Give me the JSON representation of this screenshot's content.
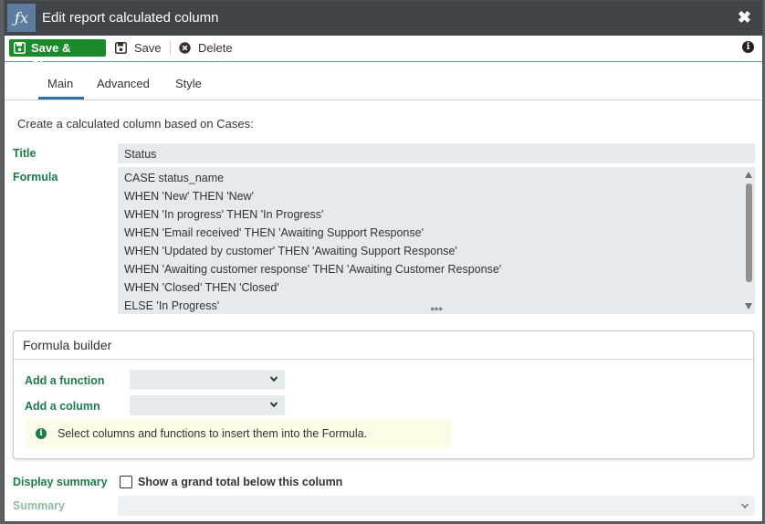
{
  "window": {
    "title": "Edit report calculated column",
    "icon": "fx-icon",
    "icon_text": "ƒx"
  },
  "toolbar": {
    "save_close_label": "Save & Close",
    "save_label": "Save",
    "delete_label": "Delete"
  },
  "tabs": [
    {
      "label": "Main",
      "active": true
    },
    {
      "label": "Advanced",
      "active": false
    },
    {
      "label": "Style",
      "active": false
    }
  ],
  "main": {
    "intro": "Create a calculated column based on Cases:",
    "title_label": "Title",
    "title_value": "Status",
    "formula_label": "Formula",
    "formula_lines": [
      "CASE status_name",
      "WHEN 'New' THEN 'New'",
      "WHEN 'In progress' THEN 'In Progress'",
      "WHEN 'Email received' THEN 'Awaiting Support Response'",
      "WHEN 'Updated by customer' THEN 'Awaiting Support Response'",
      "WHEN 'Awaiting customer response' THEN 'Awaiting Customer Response'",
      "WHEN 'Closed' THEN 'Closed'",
      "ELSE 'In Progress'"
    ]
  },
  "builder": {
    "title": "Formula builder",
    "add_function_label": "Add a function",
    "add_function_value": "",
    "add_column_label": "Add a column",
    "add_column_value": "",
    "hint": "Select columns and functions to insert them into the Formula."
  },
  "summary": {
    "display_label": "Display summary",
    "checkbox_label": "Show a grand total below this column",
    "checked": false,
    "summary_label": "Summary",
    "summary_value": ""
  },
  "colors": {
    "titlebar": "#414549",
    "primary_button": "#1a8a2a",
    "label_green": "#1f7a4a",
    "tab_accent": "#2d6ea5",
    "field_bg": "#e5eaed"
  }
}
